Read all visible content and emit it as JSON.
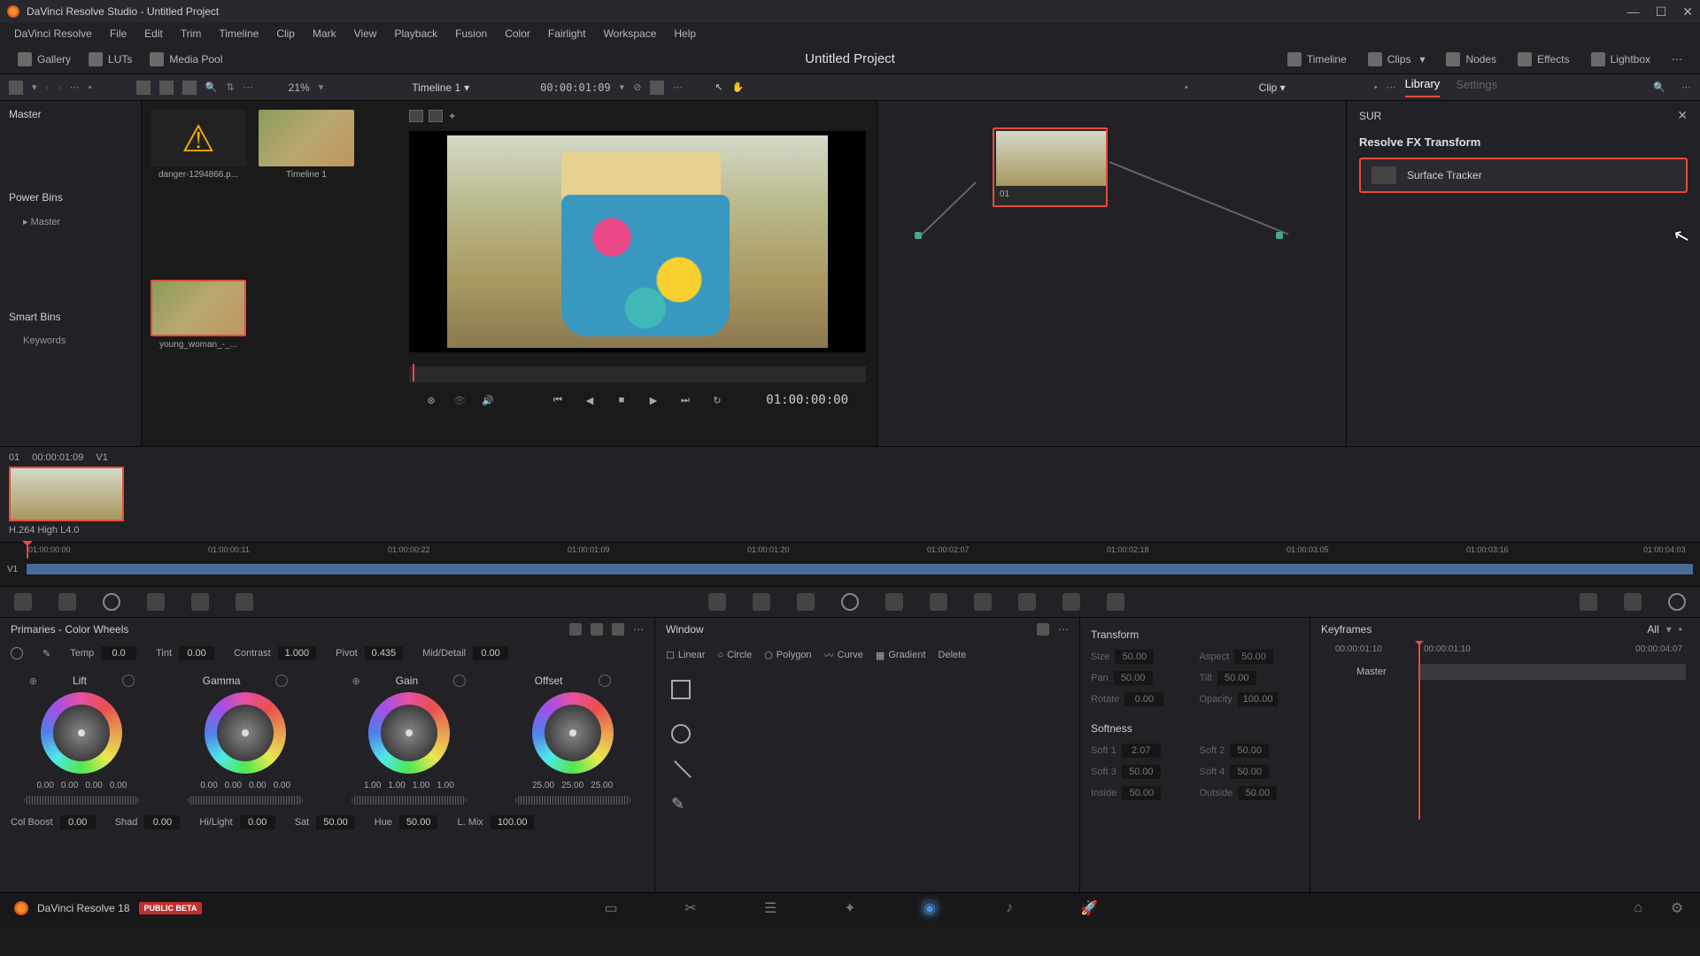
{
  "titlebar": {
    "title": "DaVinci Resolve Studio - Untitled Project"
  },
  "menubar": [
    "DaVinci Resolve",
    "File",
    "Edit",
    "Trim",
    "Timeline",
    "Clip",
    "Mark",
    "View",
    "Playback",
    "Fusion",
    "Color",
    "Fairlight",
    "Workspace",
    "Help"
  ],
  "top_toolbar": {
    "left": [
      {
        "label": "Gallery"
      },
      {
        "label": "LUTs"
      },
      {
        "label": "Media Pool"
      }
    ],
    "project_title": "Untitled Project",
    "right": [
      {
        "label": "Timeline"
      },
      {
        "label": "Clips"
      },
      {
        "label": "Nodes"
      },
      {
        "label": "Effects"
      },
      {
        "label": "Lightbox"
      }
    ]
  },
  "sub_toolbar": {
    "zoom": "21%",
    "timeline_name": "Timeline 1",
    "timecode": "00:00:01:09",
    "clip_label": "Clip",
    "tabs": {
      "library": "Library",
      "settings": "Settings"
    }
  },
  "media_pool": {
    "master": "Master",
    "power_bins": "Power Bins",
    "power_master": "Master",
    "smart_bins": "Smart Bins",
    "keywords": "Keywords"
  },
  "clips": [
    {
      "label": "danger-1294866.p..."
    },
    {
      "label": "Timeline 1"
    },
    {
      "label": "young_woman_-_..."
    }
  ],
  "viewer": {
    "timecode": "01:00:00:00"
  },
  "node": {
    "label": "01"
  },
  "effects": {
    "search": "SUR",
    "category": "Resolve FX Transform",
    "item": "Surface Tracker"
  },
  "clip_strip": {
    "index": "01",
    "timecode": "00:00:01:09",
    "track": "V1",
    "codec": "H.264 High L4.0"
  },
  "timeline_ticks": [
    "01:00:00:00",
    "01:00:00:11",
    "01:00:00:22",
    "01:00:01:09",
    "01:00:01:20",
    "01:00:02:07",
    "01:00:02:18",
    "01:00:03:05",
    "01:00:03:16",
    "01:00:04:03"
  ],
  "timeline_track": "V1",
  "primaries": {
    "title": "Primaries - Color Wheels",
    "adjust": {
      "temp_l": "Temp",
      "temp": "0.0",
      "tint_l": "Tint",
      "tint": "0.00",
      "contrast_l": "Contrast",
      "contrast": "1.000",
      "pivot_l": "Pivot",
      "pivot": "0.435",
      "middetail_l": "Mid/Detail",
      "middetail": "0.00"
    },
    "wheels": [
      {
        "name": "Lift",
        "nums": [
          "0.00",
          "0.00",
          "0.00",
          "0.00"
        ]
      },
      {
        "name": "Gamma",
        "nums": [
          "0.00",
          "0.00",
          "0.00",
          "0.00"
        ]
      },
      {
        "name": "Gain",
        "nums": [
          "1.00",
          "1.00",
          "1.00",
          "1.00"
        ]
      },
      {
        "name": "Offset",
        "nums": [
          "25.00",
          "25.00",
          "25.00"
        ]
      }
    ],
    "bottom": {
      "colboost_l": "Col Boost",
      "colboost": "0.00",
      "shad_l": "Shad",
      "shad": "0.00",
      "hilight_l": "Hi/Light",
      "hilight": "0.00",
      "sat_l": "Sat",
      "sat": "50.00",
      "hue_l": "Hue",
      "hue": "50.00",
      "lmix_l": "L. Mix",
      "lmix": "100.00"
    }
  },
  "window": {
    "title": "Window",
    "shapes": {
      "linear": "Linear",
      "circle": "Circle",
      "polygon": "Polygon",
      "curve": "Curve",
      "gradient": "Gradient",
      "delete": "Delete"
    }
  },
  "transform": {
    "title": "Transform",
    "size_l": "Size",
    "size": "50.00",
    "aspect_l": "Aspect",
    "aspect": "50.00",
    "pan_l": "Pan",
    "pan": "50.00",
    "tilt_l": "Tilt",
    "tilt": "50.00",
    "rotate_l": "Rotate",
    "rotate": "0.00",
    "opacity_l": "Opacity",
    "opacity": "100.00",
    "softness_title": "Softness",
    "soft1_l": "Soft 1",
    "soft1": "2.07",
    "soft2_l": "Soft 2",
    "soft2": "50.00",
    "soft3_l": "Soft 3",
    "soft3": "50.00",
    "soft4_l": "Soft 4",
    "soft4": "50.00",
    "inside_l": "Inside",
    "inside": "50.00",
    "outside_l": "Outside",
    "outside": "50.00"
  },
  "keyframes": {
    "title": "Keyframes",
    "all": "All",
    "tc_start": "00:00:01:10",
    "tc_mid": "00:00:01:10",
    "tc_end": "00:00:04:07",
    "master": "Master"
  },
  "footer": {
    "app": "DaVinci Resolve 18",
    "beta": "PUBLIC BETA"
  }
}
